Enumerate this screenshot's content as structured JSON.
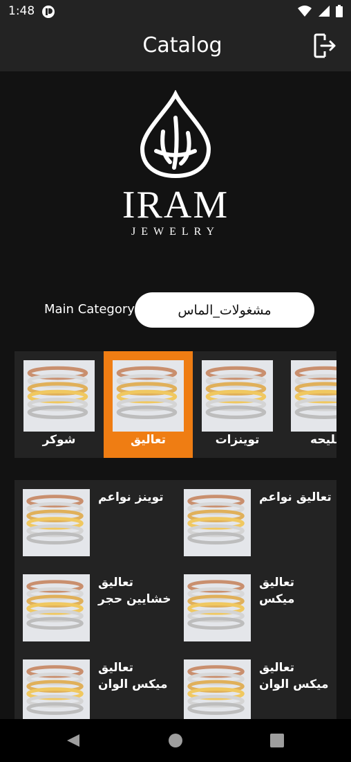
{
  "status": {
    "time": "1:48"
  },
  "header": {
    "title": "Catalog",
    "logout_icon": "logout-icon"
  },
  "logo": {
    "word": "IRAM",
    "sub": "JEWELRY"
  },
  "main_category": {
    "label": "Main Category",
    "value": "مشغولات_الماس"
  },
  "categories": [
    {
      "label": "شوكر",
      "selected": false
    },
    {
      "label": "تعاليق",
      "selected": true
    },
    {
      "label": "توينزات",
      "selected": false
    },
    {
      "label": "مليحه",
      "selected": false
    }
  ],
  "products": [
    {
      "title": "توينز نواعم"
    },
    {
      "title": "تعاليق نواعم"
    },
    {
      "title": "تعاليق\nخشايين حجر"
    },
    {
      "title": "تعاليق\nميكس"
    },
    {
      "title": "تعاليق\nميكس الوان"
    },
    {
      "title": "تعاليق\nميكس الوان"
    }
  ],
  "colors": {
    "accent": "#ef7d13",
    "panel": "#232323",
    "background": "#121212"
  }
}
